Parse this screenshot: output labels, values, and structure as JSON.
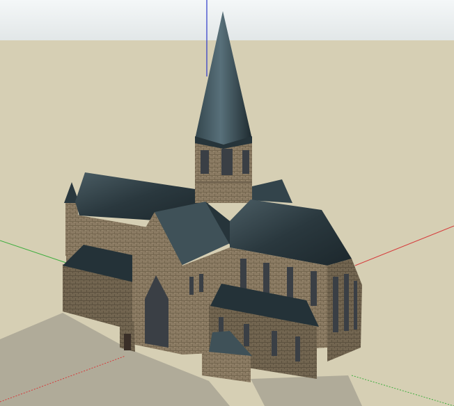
{
  "viewport": {
    "sky_color": "#e6ebec",
    "ground_color": "#d6cfb4",
    "shadow_color": "#b0ab99",
    "axis_colors": {
      "x": "#d63a3a",
      "y": "#3fae3f",
      "z": "#2a36c8"
    }
  },
  "model": {
    "roof_color": "#26343a",
    "roof_highlight": "#4e6168",
    "wall_color": "#8a7a62",
    "wall_dark": "#6d604c",
    "window_color": "#3a3f45"
  }
}
